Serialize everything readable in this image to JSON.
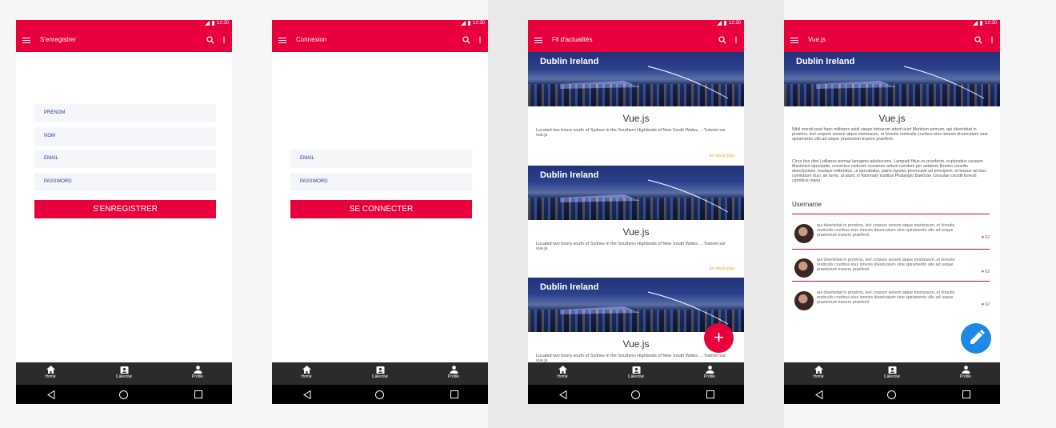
{
  "colors": {
    "primary": "#e8003d",
    "accent_link": "#f39c12",
    "fab_blue": "#1e88e5",
    "nav_bg": "#2b2b2b"
  },
  "status_time": "12:30",
  "bottom_nav": [
    "Home",
    "Calendar",
    "Profile"
  ],
  "screen1": {
    "title": "S'enregistrer",
    "fields": [
      "PRENOM",
      "NOM",
      "EMAIL",
      "PASSWORD"
    ],
    "button": "S'ENREGISTRER"
  },
  "screen2": {
    "title": "Connexion",
    "fields": [
      "EMAIL",
      "PASSWORD"
    ],
    "button": "SE CONNECTER"
  },
  "screen3": {
    "title": "Fil d'actualités",
    "cards": [
      {
        "banner": "Dublin Ireland",
        "title": "Vue.js",
        "text": "Located two hours south of Sydnes in the Southern Highlands of New South  Wales, ...Tutoriel sur vue.js",
        "link": "En savoir plus"
      },
      {
        "banner": "Dublin Ireland",
        "title": "Vue.js",
        "text": "Located two hours south of Sydnes in the Southern Highlands of New South  Wales, ...Tutoriel sur vue.js",
        "link": "En savoir plus"
      },
      {
        "banner": "Dublin Ireland",
        "title": "Vue.js",
        "text": "Located two hours south of Sydnes in the Southern Highlands of New South  Wales, ...Tutoriel sur vue.js",
        "link": ""
      }
    ],
    "fab": "+"
  },
  "screen4": {
    "title": "Vue.js",
    "banner": "Dublin Ireland",
    "heading": "Vue.js",
    "para1": "Nihil morati post haec militares avidi saepe torbarum adorti sunt Montium primum, qui divertebat in proximo, levi corpore senem atque morbosum, et hirsutis resticulis cruribus eius innexis divaricatum sine spiramento ullo ad usque praetorium traxere praefecti.",
    "para2": "Circa hos dies Lollianus primae lanuginis adulescens, Lampadi filius ex praefecto, exploratius causam Maximino spectante, convictus codicem noxiarum artium nondum per aetatem firmato consilio descripsisse, exulque mittendus, ut sperabatur, patris inpulsu provocavit ad principem, et iussus ad eius comitatum duci, de fumo, ut aiunt, in flammam traditus Phalangio Baeticae consulari cecidit funesti carnificis manu.",
    "section": "Username",
    "comments": [
      {
        "text": "qui divertebat in proximo, levi corpore senem atque morbosum, et hirsutis resticulis cruribus eius innexis divaricatum sine spiramento ullo ad usque praetorium traxere praefecti.",
        "likes": "62"
      },
      {
        "text": "qui divertebat in proximo, levi corpore senem atque morbosum, et hirsutis resticulis cruribus eius innexis divaricatum sine spiramento ullo ad usque praetorium traxere praefecti.",
        "likes": "62"
      },
      {
        "text": "qui divertebat in proximo, levi corpore senem atque morbosum, et hirsutis resticulis cruribus eius innexis divaricatum sine spiramento ullo ad usque praetorium traxere praefecti.",
        "likes": "62"
      }
    ]
  }
}
